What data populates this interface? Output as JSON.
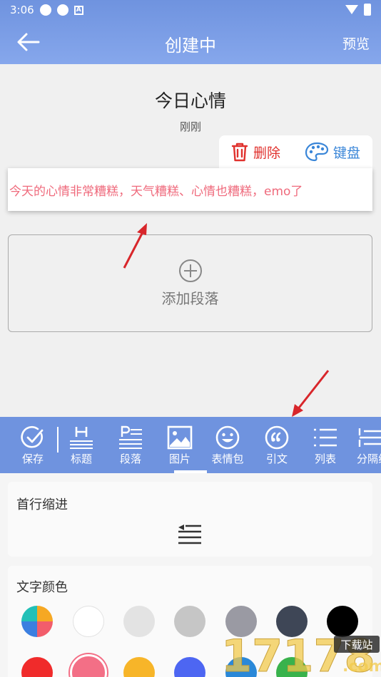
{
  "status": {
    "time": "3:06",
    "a_badge": "A"
  },
  "header": {
    "title": "创建中",
    "preview_label": "预览",
    "back_icon": "arrow-left-icon"
  },
  "document": {
    "title": "今日心情",
    "time": "刚刚"
  },
  "paragraph_actions": {
    "delete_label": "删除",
    "keyboard_label": "键盘"
  },
  "paragraph": {
    "text": "今天的心情非常糟糕，天气糟糕、心情也糟糕，emo了",
    "color": "#ef6a7c"
  },
  "add_paragraph": {
    "label": "添加段落"
  },
  "toolbar": {
    "items": [
      {
        "label": "保存",
        "icon": "check-circle-icon"
      },
      {
        "label": "标题",
        "icon": "heading-icon"
      },
      {
        "label": "段落",
        "icon": "paragraph-icon"
      },
      {
        "label": "图片",
        "icon": "image-icon"
      },
      {
        "label": "表情包",
        "icon": "emoji-icon"
      },
      {
        "label": "引文",
        "icon": "quote-icon"
      },
      {
        "label": "列表",
        "icon": "list-icon"
      },
      {
        "label": "分隔线",
        "icon": "divider-icon"
      }
    ],
    "selected": "图片"
  },
  "indent_section": {
    "title": "首行缩进"
  },
  "color_section": {
    "title": "文字颜色",
    "colors": [
      "multicolor",
      "#ffffff",
      "#e3e3e3",
      "#c6c6c6",
      "#9a9aa3",
      "#3e4656",
      "#000000",
      "#f02b2b",
      "#f36f86",
      "#f7b529",
      "#4d66f2",
      "#2a88d8",
      "#39b24c"
    ],
    "selected": "#f36f86"
  },
  "watermark": {
    "text": "17178",
    "badge": "下载站",
    "suffix": ".com"
  },
  "accent": "#6f93df"
}
